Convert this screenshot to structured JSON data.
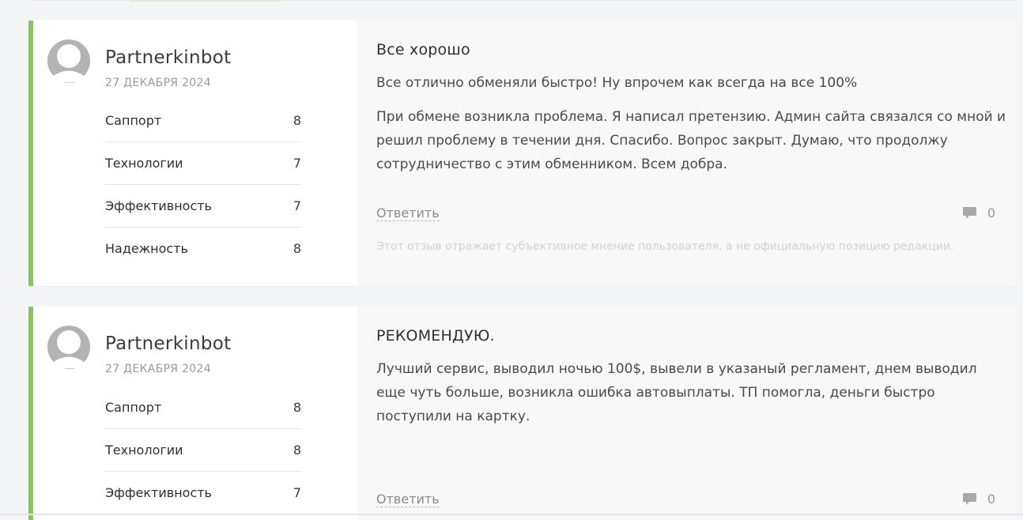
{
  "reviews": [
    {
      "author": "Partnerkinbot",
      "date": "27 ДЕКАБРЯ 2024",
      "ratings": [
        {
          "label": "Саппорт",
          "value": "8"
        },
        {
          "label": "Технологии",
          "value": "7"
        },
        {
          "label": "Эффективность",
          "value": "7"
        },
        {
          "label": "Надежность",
          "value": "8"
        }
      ],
      "title": "Все хорошо",
      "summary": "Все отлично обменяли быстро! Ну впрочем как всегда на все 100%",
      "body": "При обмене возникла проблема. Я написал претензию. Админ сайта связался со мной и решил проблему в течении дня. Спасибо. Вопрос закрыт. Думаю, что продолжу сотрудничество с этим обменником. Всем добра.",
      "reply_label": "Ответить",
      "comment_count": "0",
      "disclaimer": "Этот отзыв отражает субъективное мнение пользователя, а не официальную позицию редакции."
    },
    {
      "author": "Partnerkinbot",
      "date": "27 ДЕКАБРЯ 2024",
      "ratings": [
        {
          "label": "Саппорт",
          "value": "8"
        },
        {
          "label": "Технологии",
          "value": "8"
        },
        {
          "label": "Эффективность",
          "value": "7"
        }
      ],
      "title": "РЕКОМЕНДУЮ.",
      "body": "Лучший сервис, выводил ночью 100$, вывели в указаный регламент, днем выводил еще чуть больше, возникла ошибка автовыплаты. ТП помогла, деньги быстро поступили на картку.",
      "reply_label": "Ответить",
      "comment_count": "0"
    }
  ],
  "colors": {
    "accent": "#8dc263",
    "avatar": "#b3b3b3",
    "content_bg": "#f8f8f8"
  },
  "icons": {
    "avatar": "user-silhouette-icon",
    "comments": "speech-bubble-icon"
  }
}
